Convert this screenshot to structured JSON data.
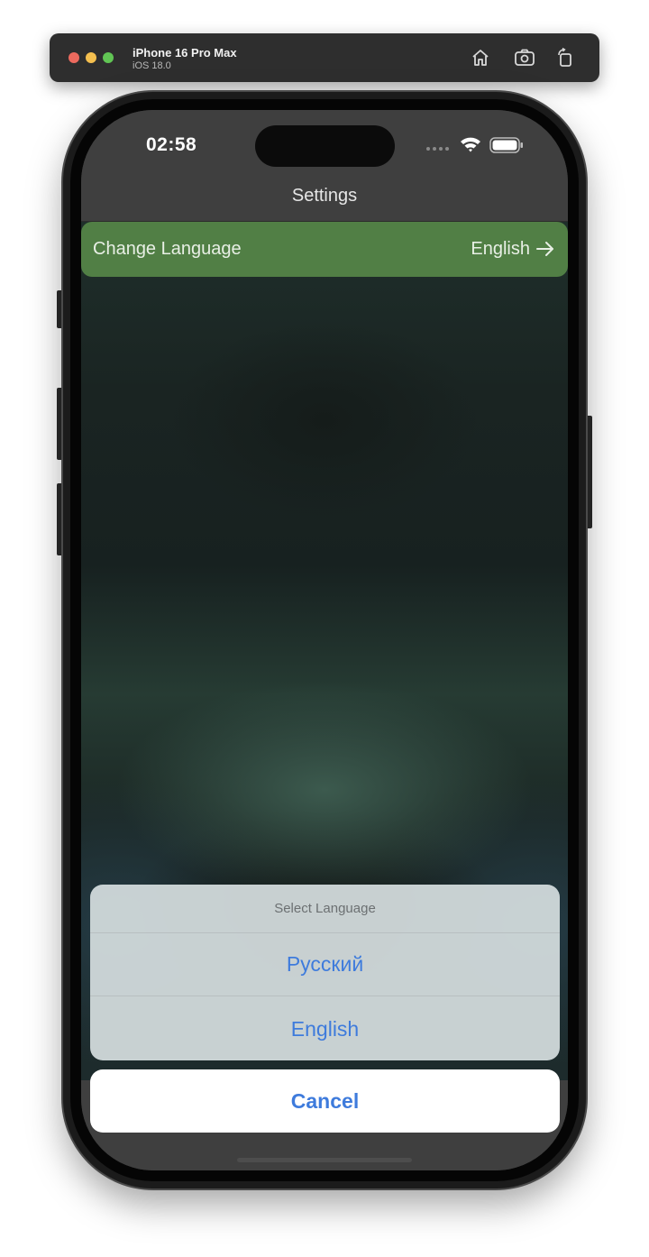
{
  "simulator": {
    "device_name": "iPhone 16 Pro Max",
    "os_version": "iOS 18.0",
    "toolbar_icons": [
      "home-icon",
      "screenshot-icon",
      "rotate-icon"
    ]
  },
  "status_bar": {
    "time": "02:58",
    "icons": [
      "cellular-icon",
      "wifi-icon",
      "battery-icon"
    ]
  },
  "nav": {
    "title": "Settings"
  },
  "settings": {
    "language_row": {
      "label": "Change Language",
      "value": "English",
      "icon": "arrow-right-icon"
    }
  },
  "action_sheet": {
    "title": "Select Language",
    "options": [
      "Русский",
      "English"
    ],
    "cancel_label": "Cancel"
  },
  "colors": {
    "accent": "#3e7bdc",
    "row_background": "#517f45",
    "sheet_background": "#d2dadb"
  }
}
